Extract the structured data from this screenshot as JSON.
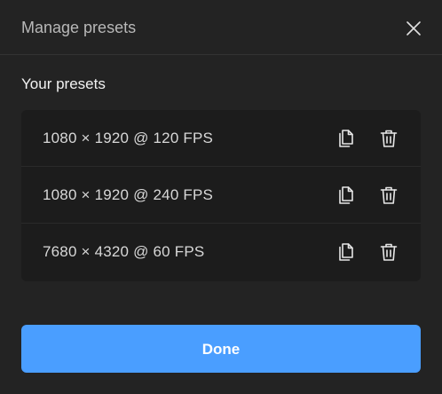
{
  "dialog": {
    "title": "Manage presets",
    "close_icon": "close-icon"
  },
  "section": {
    "title": "Your presets"
  },
  "presets": [
    {
      "label": "1080 × 1920 @ 120 FPS",
      "copy_icon": "copy-icon",
      "delete_icon": "trash-icon"
    },
    {
      "label": "1080 × 1920 @ 240 FPS",
      "copy_icon": "copy-icon",
      "delete_icon": "trash-icon"
    },
    {
      "label": "7680 × 4320 @ 60 FPS",
      "copy_icon": "copy-icon",
      "delete_icon": "trash-icon"
    }
  ],
  "footer": {
    "done_label": "Done"
  },
  "colors": {
    "background": "#232323",
    "list_background": "#1c1c1c",
    "accent": "#4a9eff",
    "text_primary": "#f2f2f2",
    "text_secondary": "#b8b8b8"
  }
}
